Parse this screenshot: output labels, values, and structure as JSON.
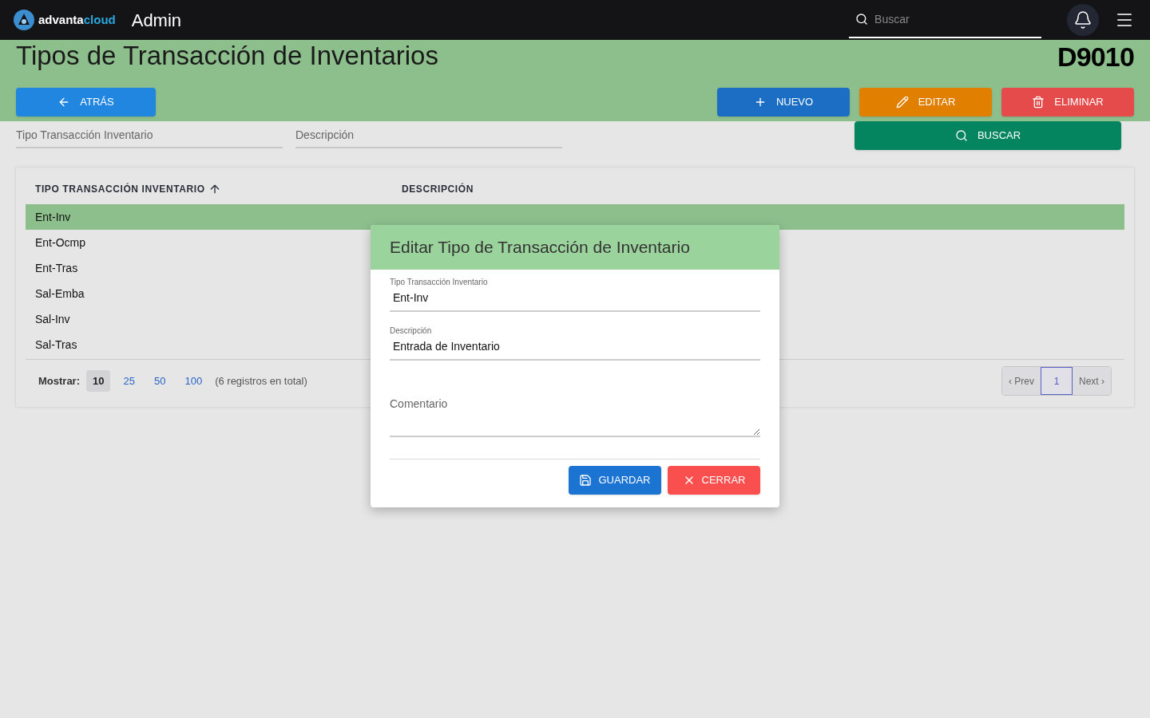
{
  "header": {
    "brand_left": "advanta",
    "brand_right": "cloud",
    "app": "Admin",
    "search": {
      "placeholder": "Buscar"
    }
  },
  "page": {
    "title": "Tipos de Transacción de Inventarios",
    "code": "D9010"
  },
  "actions": [
    {
      "kind": "back",
      "label": "ATRÁS"
    },
    {
      "kind": "new",
      "label": "NUEVO"
    },
    {
      "kind": "edit",
      "label": "EDITAR"
    },
    {
      "kind": "delete",
      "label": "ELIMINAR"
    }
  ],
  "search_button": "BUSCAR",
  "filters": [
    {
      "placeholder": "Tipo Transacción Inventario"
    },
    {
      "placeholder": "Descripción"
    }
  ],
  "table": {
    "columns": [
      {
        "label": "TIPO TRANSACCIÓN INVENTARIO",
        "sorted": true
      },
      {
        "label": "DESCRIPCIÓN",
        "sorted": false
      }
    ],
    "rows": [
      {
        "code": "Ent-Inv",
        "selected": true
      },
      {
        "code": "Ent-Ocmp",
        "selected": false
      },
      {
        "code": "Ent-Tras",
        "selected": false
      },
      {
        "code": "Sal-Emba",
        "selected": false
      },
      {
        "code": "Sal-Inv",
        "selected": false
      },
      {
        "code": "Sal-Tras",
        "selected": false
      }
    ]
  },
  "footer": {
    "show_label": "Mostrar:",
    "sizes": [
      {
        "label": "10",
        "selected": true
      },
      {
        "label": "25",
        "selected": false
      },
      {
        "label": "50",
        "selected": false
      },
      {
        "label": "100",
        "selected": false
      }
    ],
    "total": "(6 registros en total)",
    "pages": [
      {
        "label": "‹ Prev",
        "selected": false
      },
      {
        "label": "1",
        "selected": true
      },
      {
        "label": "Next ›",
        "selected": false
      }
    ]
  },
  "dialog": {
    "title": "Editar Tipo de Transacción de Inventario",
    "fields": [
      {
        "label": "Tipo Transacción Inventario",
        "value": "Ent-Inv"
      },
      {
        "label": "Descripción",
        "value": "Entrada de Inventario"
      }
    ],
    "comment": {
      "placeholder": "Comentario"
    },
    "buttons": [
      {
        "kind": "save",
        "label": "GUARDAR"
      },
      {
        "kind": "close",
        "label": "CERRAR"
      }
    ]
  }
}
